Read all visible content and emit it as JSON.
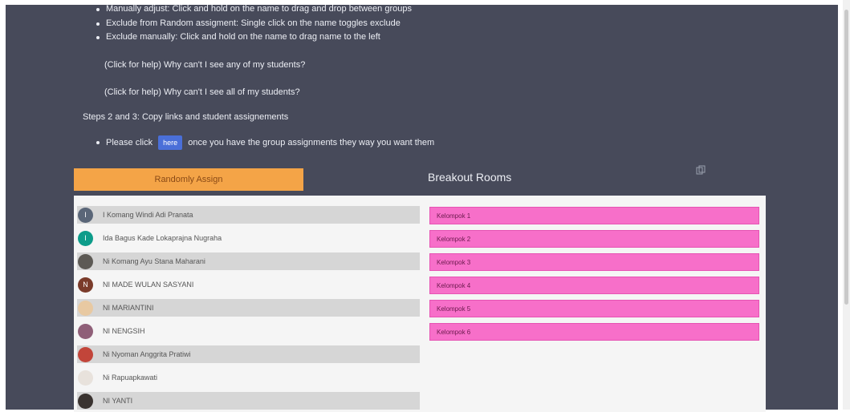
{
  "instructions": {
    "bullets": [
      "Manually adjust: Click and hold on the name to drag and drop between groups",
      "Exclude from Random assigment: Single click on the name toggles exclude",
      "Exclude manually: Click and hold on the name to drag name to the left"
    ],
    "help_links": [
      "(Click for help) Why can't I see any of my students?",
      "(Click for help) Why can't I see all of my students?"
    ],
    "steps_heading": "Steps 2 and 3: Copy links and student assignements",
    "click_prefix": "Please click",
    "here_label": "here",
    "click_suffix": "once you have the group assignments they way you want them"
  },
  "random_assign_label": "Randomly Assign",
  "breakout_rooms_title": "Breakout Rooms",
  "students": [
    {
      "name": "I Komang Windi Adi Pranata",
      "avatar": "I",
      "avatar_color": "#5a6678"
    },
    {
      "name": "Ida Bagus Kade Lokaprajna Nugraha",
      "avatar": "I",
      "avatar_color": "#0d9c8a"
    },
    {
      "name": "Ni Komang Ayu Stana Maharani",
      "avatar": "photo",
      "avatar_color": "#5d5a55"
    },
    {
      "name": "NI MADE WULAN SASYANI",
      "avatar": "N",
      "avatar_color": "#7a3b2a"
    },
    {
      "name": "NI MARIANTINI",
      "avatar": "photo",
      "avatar_color": "#e8c9a2"
    },
    {
      "name": "NI NENGSIH",
      "avatar": "photo",
      "avatar_color": "#8f5f78"
    },
    {
      "name": "Ni Nyoman Anggrita Pratiwi",
      "avatar": "photo",
      "avatar_color": "#c2453a"
    },
    {
      "name": "Ni Rapuapkawati",
      "avatar": "photo",
      "avatar_color": "#e8e2dc"
    },
    {
      "name": "NI YANTI",
      "avatar": "photo",
      "avatar_color": "#3a3330"
    }
  ],
  "groups": [
    "Kelompok 1",
    "Kelompok 2",
    "Kelompok 3",
    "Kelompok 4",
    "Kelompok 5",
    "Kelompok 6"
  ]
}
